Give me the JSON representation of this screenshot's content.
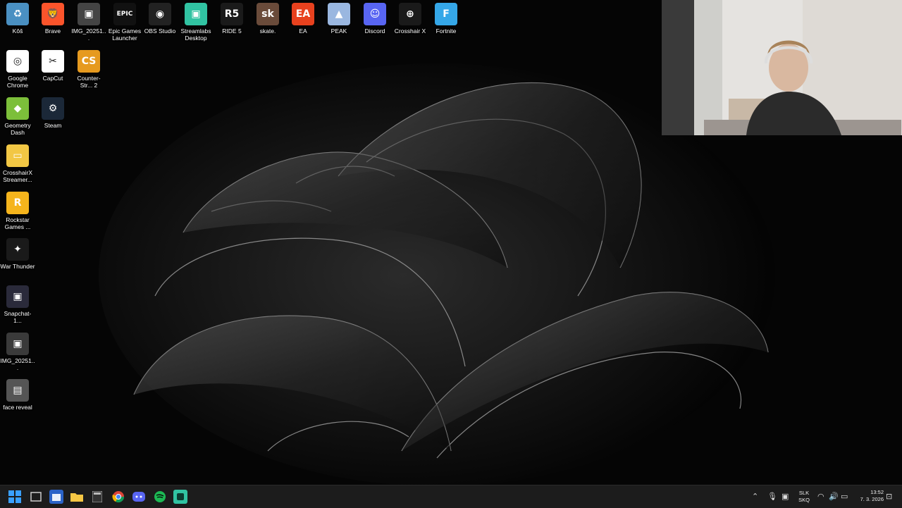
{
  "desktop_icons": [
    {
      "label": "Kôš",
      "color": "#4a90c2",
      "glyph": "♻"
    },
    {
      "label": "Brave",
      "color": "#fb542b",
      "glyph": "🦁"
    },
    {
      "label": "IMG_20251...",
      "color": "#444",
      "glyph": "▣"
    },
    {
      "label": "Epic Games Launcher",
      "color": "#111",
      "glyph": "EPIC"
    },
    {
      "label": "OBS Studio",
      "color": "#222",
      "glyph": "◉"
    },
    {
      "label": "Streamlabs Desktop",
      "color": "#31c3a2",
      "glyph": "▣"
    },
    {
      "label": "RIDE 5",
      "color": "#1a1a1a",
      "glyph": "R5"
    },
    {
      "label": "skate.",
      "color": "#6a4b3a",
      "glyph": "sk"
    },
    {
      "label": "EA",
      "color": "#e8411e",
      "glyph": "EA"
    },
    {
      "label": "PEAK",
      "color": "#9ab7e0",
      "glyph": "▲"
    },
    {
      "label": "Discord",
      "color": "#5865f2",
      "glyph": "☺"
    },
    {
      "label": "Crosshair X",
      "color": "#1a1a1a",
      "glyph": "⊕"
    },
    {
      "label": "Fortnite",
      "color": "#35a7e8",
      "glyph": "F"
    },
    {
      "label": "Google Chrome",
      "color": "#fff",
      "glyph": "◎"
    },
    {
      "label": "CapCut",
      "color": "#fff",
      "glyph": "✂"
    },
    {
      "label": "Counter-Str... 2",
      "color": "#e69a1f",
      "glyph": "CS"
    },
    {
      "label": "Geometry Dash",
      "color": "#7cbf3a",
      "glyph": "◆"
    },
    {
      "label": "Steam",
      "color": "#1b2838",
      "glyph": "⚙"
    },
    {
      "label": "CrosshairX Streamer...",
      "color": "#f2c744",
      "glyph": "▭"
    },
    {
      "label": "Rockstar Games ...",
      "color": "#f5b41c",
      "glyph": "R"
    },
    {
      "label": "War Thunder",
      "color": "#1a1a1a",
      "glyph": "✦"
    },
    {
      "label": "Snapchat-1...",
      "color": "#2a2a3a",
      "glyph": "▣"
    },
    {
      "label": "IMG_20251...",
      "color": "#3a3a3a",
      "glyph": "▣"
    },
    {
      "label": "face reveal",
      "color": "#555",
      "glyph": "▤"
    }
  ],
  "tray": {
    "lang_line1": "SLK",
    "lang_line2": "SKQ",
    "time": "13:52",
    "date": "7. 3. 2026"
  },
  "taskbar_apps": [
    "start-icon",
    "search-icon",
    "store-icon",
    "file-explorer-icon",
    "calculator-icon",
    "chrome-icon",
    "discord-icon",
    "spotify-icon",
    "streamlabs-icon"
  ]
}
